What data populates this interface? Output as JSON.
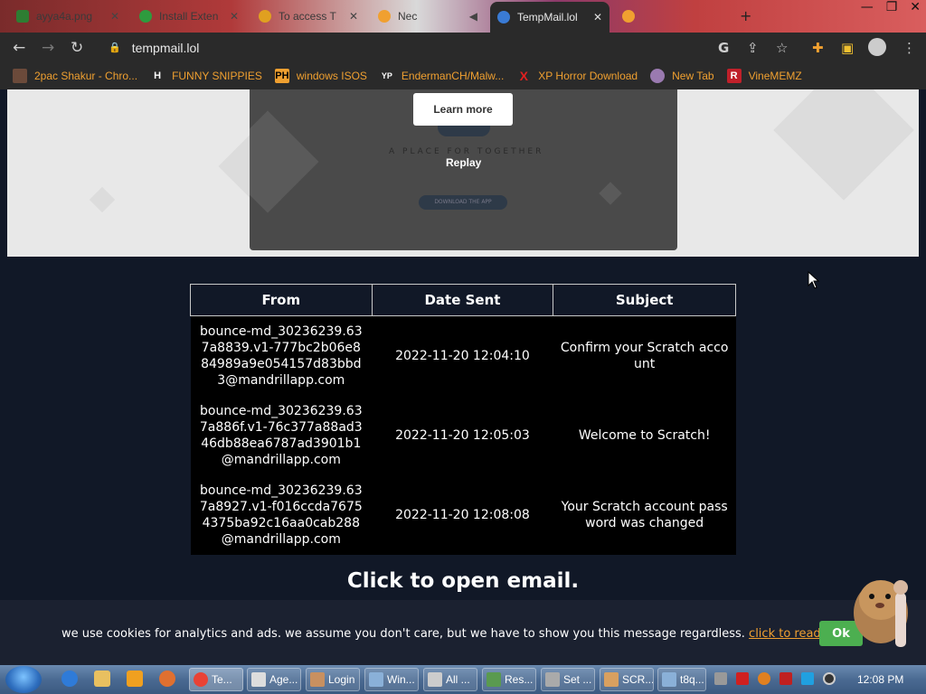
{
  "browser": {
    "tabs": [
      {
        "label": "ayya4a.png",
        "active": false
      },
      {
        "label": "Install Exten",
        "active": false
      },
      {
        "label": "To access T",
        "active": false
      },
      {
        "label": "Nec",
        "active": false
      },
      {
        "label": "TempMail.lol",
        "active": true
      },
      {
        "label": "",
        "active": false
      }
    ],
    "url": "tempmail.lol",
    "bookmarks": [
      {
        "label": "2pac Shakur - Chro...",
        "icon": "2pac-icon"
      },
      {
        "label": "FUNNY SNIPPIES",
        "icon": "H"
      },
      {
        "label": "windows ISOS",
        "icon": "PH"
      },
      {
        "label": "EndermanCH/Malw...",
        "icon": "YP"
      },
      {
        "label": "XP Horror Download",
        "icon": "X"
      },
      {
        "label": "New Tab",
        "icon": "globe-icon"
      },
      {
        "label": "VineMEMZ",
        "icon": "R"
      }
    ]
  },
  "banner": {
    "learn_more": "Learn more",
    "tagline": "A PLACE FOR TOGETHER",
    "replay": "Replay",
    "download": "DOWNLOAD THE APP"
  },
  "table": {
    "headers": [
      "From",
      "Date Sent",
      "Subject"
    ],
    "rows": [
      {
        "from": "bounce-md_30236239.637a8839.v1-777bc2b06e884989a9e054157d83bbd3@mandrillapp.com",
        "date": "2022-11-20 12:04:10",
        "subject": "Confirm your Scratch account"
      },
      {
        "from": "bounce-md_30236239.637a886f.v1-76c377a88ad346db88ea6787ad3901b1@mandrillapp.com",
        "date": "2022-11-20 12:05:03",
        "subject": "Welcome to Scratch!"
      },
      {
        "from": "bounce-md_30236239.637a8927.v1-f016ccda76754375ba92c16aa0cab288@mandrillapp.com",
        "date": "2022-11-20 12:08:08",
        "subject": "Your Scratch account password was changed"
      }
    ]
  },
  "cta": "Click to open email.",
  "cookie": {
    "text": "we use cookies for analytics and ads. we assume you don't care, but we have to show you this message regardless.",
    "link": "click to read more",
    "ok": "Ok"
  },
  "taskbar": {
    "items": [
      "Te...",
      "Age...",
      "Login",
      "Win...",
      "All ...",
      "Res...",
      "Set ...",
      "SCR...",
      "t8q..."
    ],
    "clock": "12:08 PM"
  },
  "colors": {
    "page_bg": "#111827",
    "accent_link": "#f0a030",
    "ok_button": "#4caf50"
  }
}
